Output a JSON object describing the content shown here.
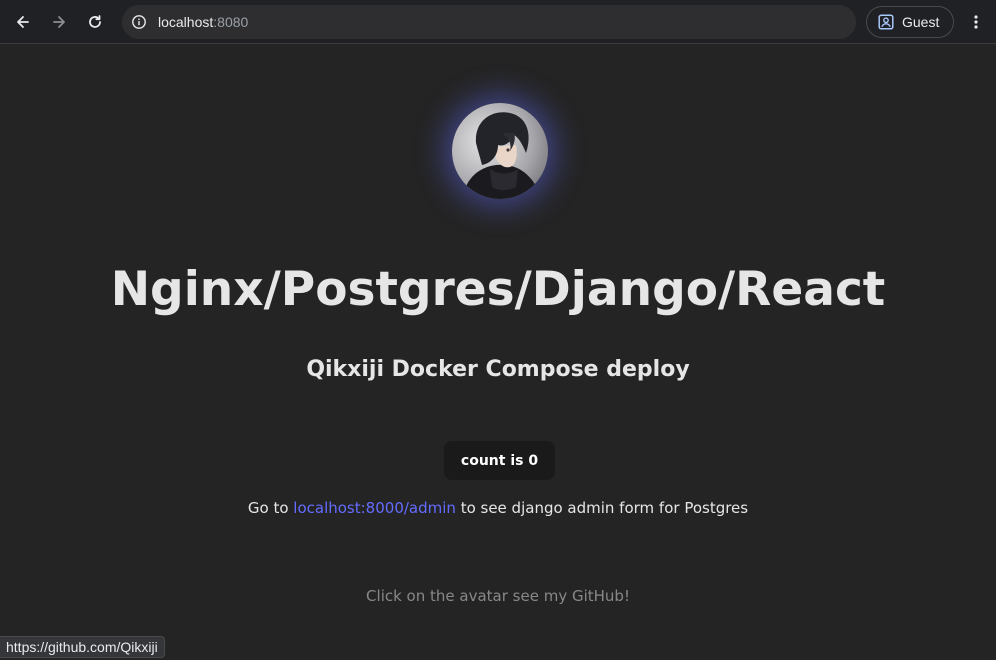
{
  "browser": {
    "url_host": "localhost",
    "url_port": ":8080",
    "profile_label": "Guest"
  },
  "page": {
    "title": "Nginx/Postgres/Django/React",
    "subtitle": "Qikxiji Docker Compose deploy",
    "count_label": "count is 0",
    "admin_prefix": "Go to ",
    "admin_link_text": "localhost:8000/admin",
    "admin_suffix": " to see django admin form for Postgres",
    "hint": "Click on the avatar see my GitHub!"
  },
  "status_bar": {
    "link_url": "https://github.com/Qikxiji"
  },
  "colors": {
    "background": "#242424",
    "link_accent": "#646cff",
    "avatar_glow": "#646cff",
    "button_bg": "#1a1a1a"
  }
}
